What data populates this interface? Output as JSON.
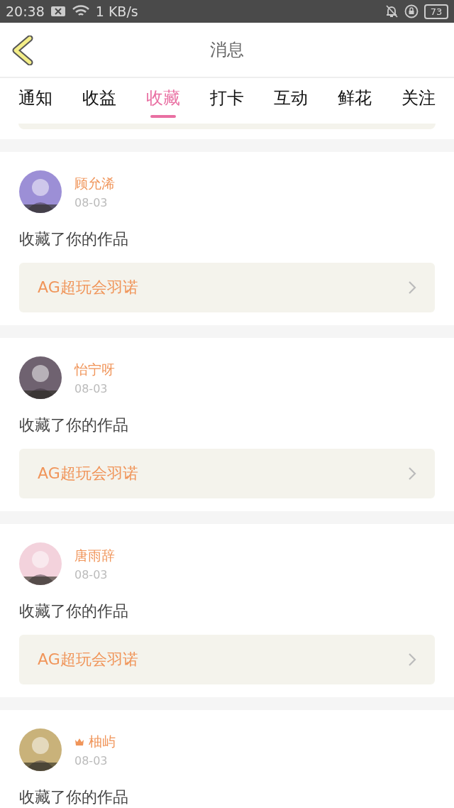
{
  "status_bar": {
    "time": "20:38",
    "speed": "1 KB/s",
    "battery": "73"
  },
  "header": {
    "title": "消息"
  },
  "tabs": [
    {
      "label": "通知",
      "selected": false
    },
    {
      "label": "收益",
      "selected": false
    },
    {
      "label": "收藏",
      "selected": true
    },
    {
      "label": "打卡",
      "selected": false
    },
    {
      "label": "互动",
      "selected": false
    },
    {
      "label": "鲜花",
      "selected": false
    },
    {
      "label": "关注",
      "selected": false
    }
  ],
  "messages": [
    {
      "name": "顾允浠",
      "crowned": false,
      "date": "08-03",
      "text": "收藏了你的作品",
      "work": "AG超玩会羽诺"
    },
    {
      "name": "怡宁呀",
      "crowned": false,
      "date": "08-03",
      "text": "收藏了你的作品",
      "work": "AG超玩会羽诺"
    },
    {
      "name": "唐雨辞",
      "crowned": false,
      "date": "08-03",
      "text": "收藏了你的作品",
      "work": "AG超玩会羽诺"
    },
    {
      "name": "柚屿",
      "crowned": true,
      "date": "08-03",
      "text": "收藏了你的作品"
    }
  ]
}
